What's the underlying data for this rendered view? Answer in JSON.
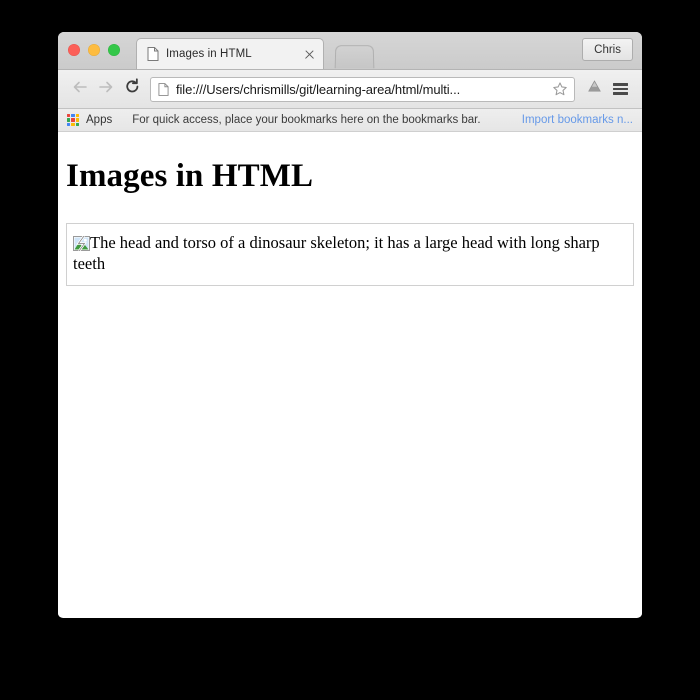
{
  "window": {
    "traffic_lights": [
      {
        "name": "close",
        "color": "#fc5f58"
      },
      {
        "name": "minimize",
        "color": "#fdbc40"
      },
      {
        "name": "zoom",
        "color": "#34c749"
      }
    ]
  },
  "tab_strip": {
    "active_tab": {
      "title": "Images in HTML",
      "favicon": "page-icon",
      "close_icon": "close-icon"
    },
    "new_tab_icon": "new-tab-button",
    "profile_label": "Chris"
  },
  "toolbar": {
    "back_icon": "back-arrow-icon",
    "forward_icon": "forward-arrow-icon",
    "reload_icon": "reload-icon",
    "omnibox": {
      "favicon": "page-icon",
      "url": "file:///Users/chrismills/git/learning-area/html/multi...",
      "placeholder": "Search Google or type URL",
      "star_icon": "star-icon"
    },
    "drive_icon": "google-drive-icon",
    "menu_icon": "hamburger-menu-icon"
  },
  "bookmarks_bar": {
    "apps_icon": "apps-grid-icon",
    "apps_colors": [
      "#e8453c",
      "#4285f4",
      "#fbbc05",
      "#34a853",
      "#e8453c",
      "#fbbc05",
      "#4285f4",
      "#fbbc05",
      "#34a853"
    ],
    "apps_label": "Apps",
    "hint_text": "For quick access, place your bookmarks here on the bookmarks bar.",
    "import_link": "Import bookmarks n...",
    "import_link_color": "#6699e8"
  },
  "page": {
    "heading": "Images in HTML",
    "image": {
      "state": "broken",
      "broken_icon": "broken-image-icon",
      "alt_text": "The head and torso of a dinosaur skeleton; it has a large head with long sharp teeth"
    }
  }
}
